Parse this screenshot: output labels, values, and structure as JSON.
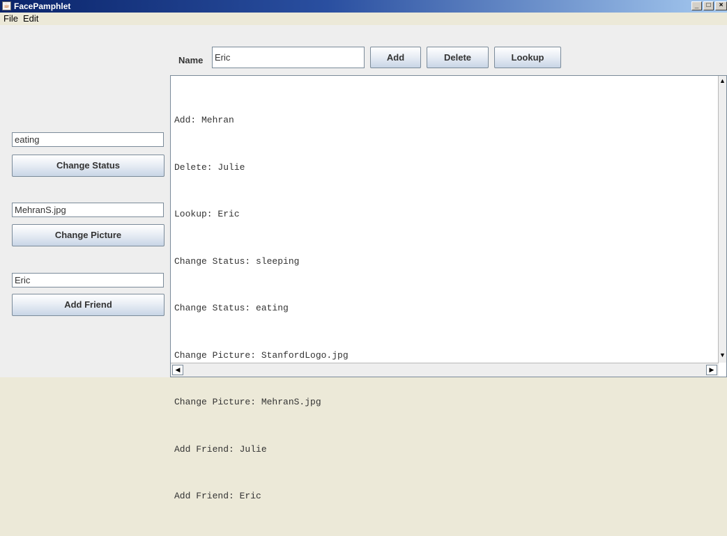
{
  "window": {
    "title": "FacePamphlet",
    "app_icon": "java-cup-icon",
    "controls": {
      "minimize": "_",
      "maximize": "□",
      "close": "×"
    }
  },
  "menu": {
    "items": [
      "File",
      "Edit"
    ]
  },
  "toolbar": {
    "name_label": "Name",
    "name_value": "Eric",
    "add_label": "Add",
    "delete_label": "Delete",
    "lookup_label": "Lookup"
  },
  "sidebar": {
    "status_value": "eating",
    "change_status_label": "Change Status",
    "picture_value": "MehranS.jpg",
    "change_picture_label": "Change Picture",
    "friend_value": "Eric",
    "add_friend_label": "Add Friend"
  },
  "console": {
    "lines": [
      "Add: Mehran",
      "Delete: Julie",
      "Lookup: Eric",
      "Change Status: sleeping",
      "Change Status: eating",
      "Change Picture: StanfordLogo.jpg",
      "Change Picture: MehranS.jpg",
      "Add Friend: Julie",
      "Add Friend: Eric"
    ]
  },
  "scrollbar_arrows": {
    "up": "▲",
    "down": "▼",
    "left": "◀",
    "right": "▶"
  },
  "colors": {
    "titlebar_start": "#0a246a",
    "titlebar_end": "#a6caf0",
    "background": "#eeeeee"
  }
}
